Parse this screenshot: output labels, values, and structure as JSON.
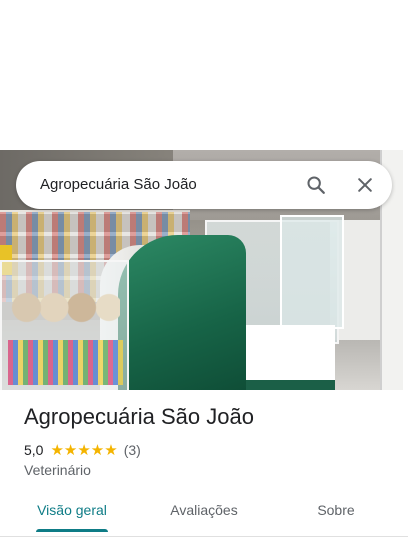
{
  "search": {
    "query": "Agropecuária São João"
  },
  "icons": {
    "search": "search-icon",
    "close": "close-icon"
  },
  "place": {
    "name": "Agropecuária São João",
    "rating_text": "5,0",
    "rating_value": 5.0,
    "stars": "★★★★★",
    "review_count": "(3)",
    "category": "Veterinário"
  },
  "tabs": [
    {
      "label": "Visão geral",
      "active": true
    },
    {
      "label": "Avaliações",
      "active": false
    },
    {
      "label": "Sobre",
      "active": false
    }
  ],
  "colors": {
    "accent": "#0e7c86",
    "star": "#f4b400"
  }
}
